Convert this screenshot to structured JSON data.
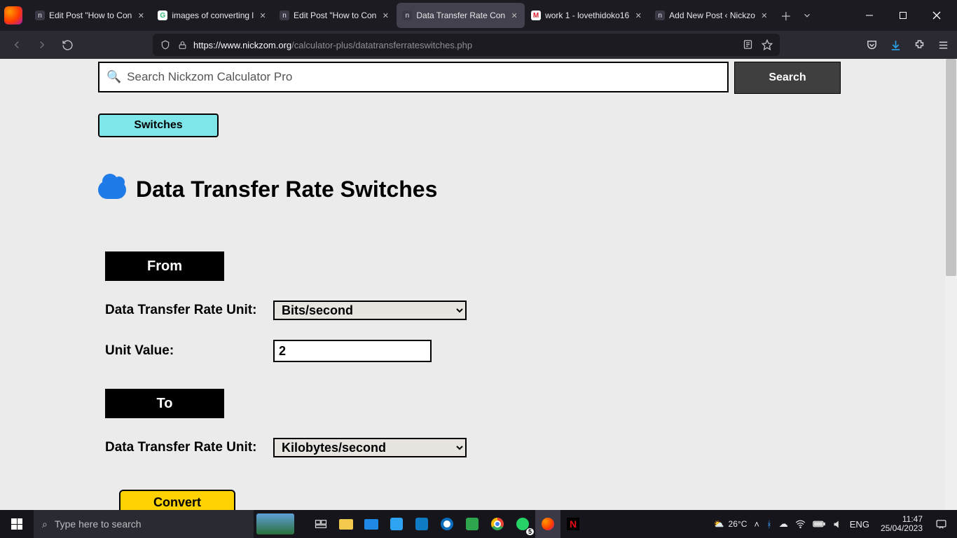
{
  "browser": {
    "tabs": [
      {
        "label": "Edit Post \"How to Con",
        "favicon": "n"
      },
      {
        "label": "images of converting l",
        "favicon": "G"
      },
      {
        "label": "Edit Post \"How to Con",
        "favicon": "n"
      },
      {
        "label": "Data Transfer Rate Con",
        "favicon": "n",
        "active": true
      },
      {
        "label": "work 1 - lovethidoko16",
        "favicon": "M"
      },
      {
        "label": "Add New Post ‹ Nickzo",
        "favicon": "n"
      }
    ],
    "url_host": "https://www.nickzom.org",
    "url_path": "/calculator-plus/datatransferrateswitches.php"
  },
  "page": {
    "search_placeholder": "Search Nickzom Calculator Pro",
    "search_button": "Search",
    "switches_button": "Switches",
    "title": "Data Transfer Rate Switches",
    "from_label": "From",
    "to_label": "To",
    "unit_label": "Data Transfer Rate Unit:",
    "value_label": "Unit Value:",
    "from_unit_selected": "Bits/second",
    "unit_value": "2",
    "to_unit_selected": "Kilobytes/second",
    "convert": "Convert"
  },
  "taskbar": {
    "search_placeholder": "Type here to search",
    "weather_temp": "26°C",
    "lang": "ENG",
    "time": "11:47",
    "date": "25/04/2023",
    "whatsapp_badge": "5"
  }
}
